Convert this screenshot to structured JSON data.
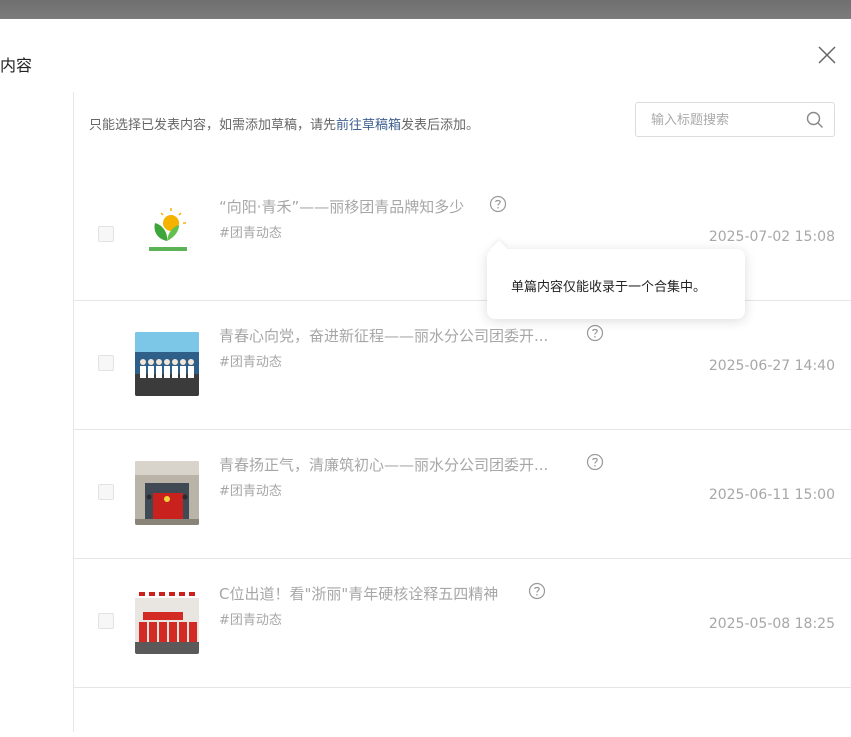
{
  "dialog": {
    "title": "内容"
  },
  "hint": {
    "before": "只能选择已发表内容，如需添加草稿，请先",
    "link": "前往草稿箱",
    "after": "发表后添加。"
  },
  "search": {
    "placeholder": "输入标题搜索"
  },
  "items": [
    {
      "title": "“向阳·青禾”——丽移团青品牌知多少",
      "tag": "#团青动态",
      "date": "2025-07-02 15:08",
      "thumb_icon": "leaf-logo-icon"
    },
    {
      "title": "青春心向党，奋进新征程——丽水分公司团委开...",
      "tag": "#团青动态",
      "date": "2025-06-27 14:40",
      "thumb_icon": "group-photo-icon"
    },
    {
      "title": "青春扬正气，清廉筑初心——丽水分公司团委开...",
      "tag": "#团青动态",
      "date": "2025-06-11 15:00",
      "thumb_icon": "flag-photo-icon"
    },
    {
      "title": "C位出道！看\"浙丽\"青年硬核诠释五四精神",
      "tag": "#团青动态",
      "date": "2025-05-08 18:25",
      "thumb_icon": "banner-photo-icon"
    }
  ],
  "tooltip": {
    "text": "单篇内容仅能收录于一个合集中。"
  },
  "colors": {
    "link": "#3d5f8f",
    "muted_text": "#a7a7a7"
  }
}
